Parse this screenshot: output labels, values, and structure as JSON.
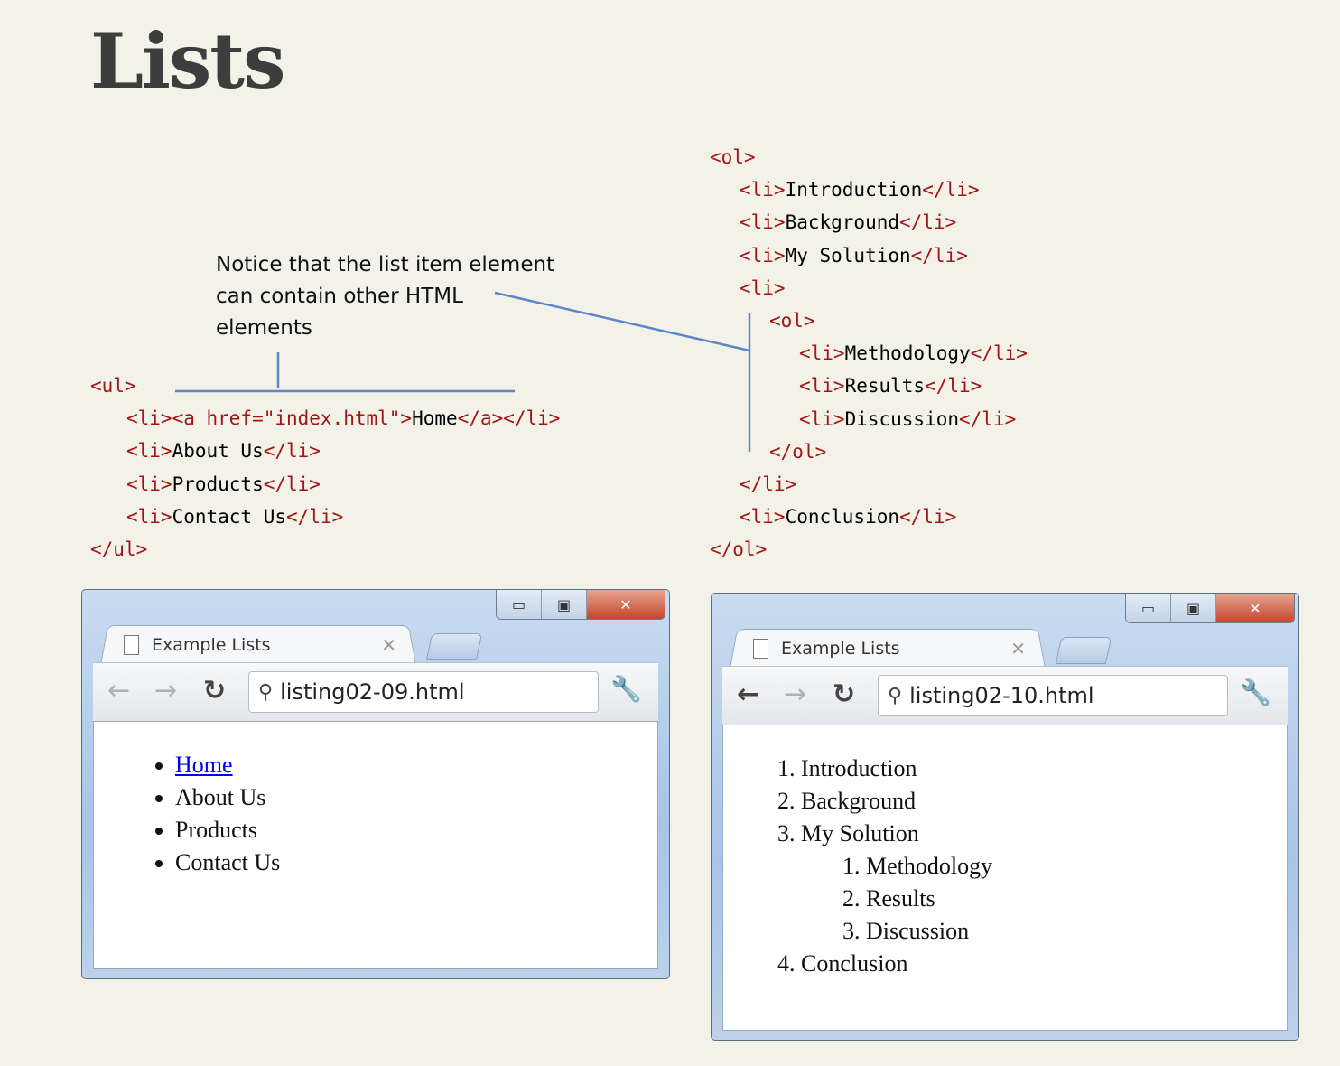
{
  "page": {
    "title": "Lists"
  },
  "note": {
    "lines": [
      "Notice that the list item element",
      "can contain other HTML",
      "elements"
    ]
  },
  "code_ul": {
    "lines": [
      [
        {
          "t": "tag",
          "v": "<ul>"
        }
      ],
      [
        {
          "t": "tag",
          "v": "<li><a href=\"index.html\">"
        },
        {
          "t": "txt",
          "v": "Home"
        },
        {
          "t": "tag",
          "v": "</a></li>"
        }
      ],
      [
        {
          "t": "tag",
          "v": "<li>"
        },
        {
          "t": "txt",
          "v": "About Us"
        },
        {
          "t": "tag",
          "v": "</li>"
        }
      ],
      [
        {
          "t": "tag",
          "v": "<li>"
        },
        {
          "t": "txt",
          "v": "Products"
        },
        {
          "t": "tag",
          "v": "</li>"
        }
      ],
      [
        {
          "t": "tag",
          "v": "<li>"
        },
        {
          "t": "txt",
          "v": "Contact Us"
        },
        {
          "t": "tag",
          "v": "</li>"
        }
      ],
      [
        {
          "t": "tag",
          "v": "</ul>"
        }
      ]
    ],
    "indents": [
      0,
      1,
      1,
      1,
      1,
      0
    ]
  },
  "code_ol": {
    "lines": [
      [
        {
          "t": "tag",
          "v": "<ol>"
        }
      ],
      [
        {
          "t": "tag",
          "v": "<li>"
        },
        {
          "t": "txt",
          "v": "Introduction"
        },
        {
          "t": "tag",
          "v": "</li>"
        }
      ],
      [
        {
          "t": "tag",
          "v": "<li>"
        },
        {
          "t": "txt",
          "v": "Background"
        },
        {
          "t": "tag",
          "v": "</li>"
        }
      ],
      [
        {
          "t": "tag",
          "v": "<li>"
        },
        {
          "t": "txt",
          "v": "My Solution"
        },
        {
          "t": "tag",
          "v": "</li>"
        }
      ],
      [
        {
          "t": "tag",
          "v": "<li>"
        }
      ],
      [
        {
          "t": "tag",
          "v": "<ol>"
        }
      ],
      [
        {
          "t": "tag",
          "v": "<li>"
        },
        {
          "t": "txt",
          "v": "Methodology"
        },
        {
          "t": "tag",
          "v": "</li>"
        }
      ],
      [
        {
          "t": "tag",
          "v": "<li>"
        },
        {
          "t": "txt",
          "v": "Results"
        },
        {
          "t": "tag",
          "v": "</li>"
        }
      ],
      [
        {
          "t": "tag",
          "v": "<li>"
        },
        {
          "t": "txt",
          "v": "Discussion"
        },
        {
          "t": "tag",
          "v": "</li>"
        }
      ],
      [
        {
          "t": "tag",
          "v": "</ol>"
        }
      ],
      [
        {
          "t": "tag",
          "v": "</li>"
        }
      ],
      [
        {
          "t": "tag",
          "v": "<li>"
        },
        {
          "t": "txt",
          "v": "Conclusion"
        },
        {
          "t": "tag",
          "v": "</li>"
        }
      ],
      [
        {
          "t": "tag",
          "v": "</ol>"
        }
      ]
    ],
    "indents": [
      0,
      1,
      1,
      1,
      1,
      2,
      3,
      3,
      3,
      2,
      1,
      1,
      0
    ]
  },
  "browser1": {
    "tab_title": "Example Lists",
    "url": "listing02-09.html",
    "back_enabled": false,
    "list_items": [
      {
        "label": "Home",
        "link": true
      },
      {
        "label": "About Us",
        "link": false
      },
      {
        "label": "Products",
        "link": false
      },
      {
        "label": "Contact Us",
        "link": false
      }
    ]
  },
  "browser2": {
    "tab_title": "Example Lists",
    "url": "listing02-10.html",
    "back_enabled": true,
    "list_items": [
      {
        "label": "Introduction",
        "children": []
      },
      {
        "label": "Background",
        "children": []
      },
      {
        "label": "My Solution",
        "children": [
          "Methodology",
          "Results",
          "Discussion"
        ]
      },
      {
        "label": "Conclusion",
        "children": []
      }
    ]
  },
  "icons": {
    "minimize": "minimize-icon",
    "maximize": "maximize-icon",
    "close": "close-icon",
    "back": "back-arrow-icon",
    "forward": "forward-arrow-icon",
    "reload": "reload-icon",
    "search": "search-icon",
    "wrench": "wrench-icon",
    "page": "page-icon"
  },
  "colors": {
    "background": "#f3f2e8",
    "tag": "#a31515",
    "callout": "#5b86c9",
    "link": "#0000ee"
  }
}
